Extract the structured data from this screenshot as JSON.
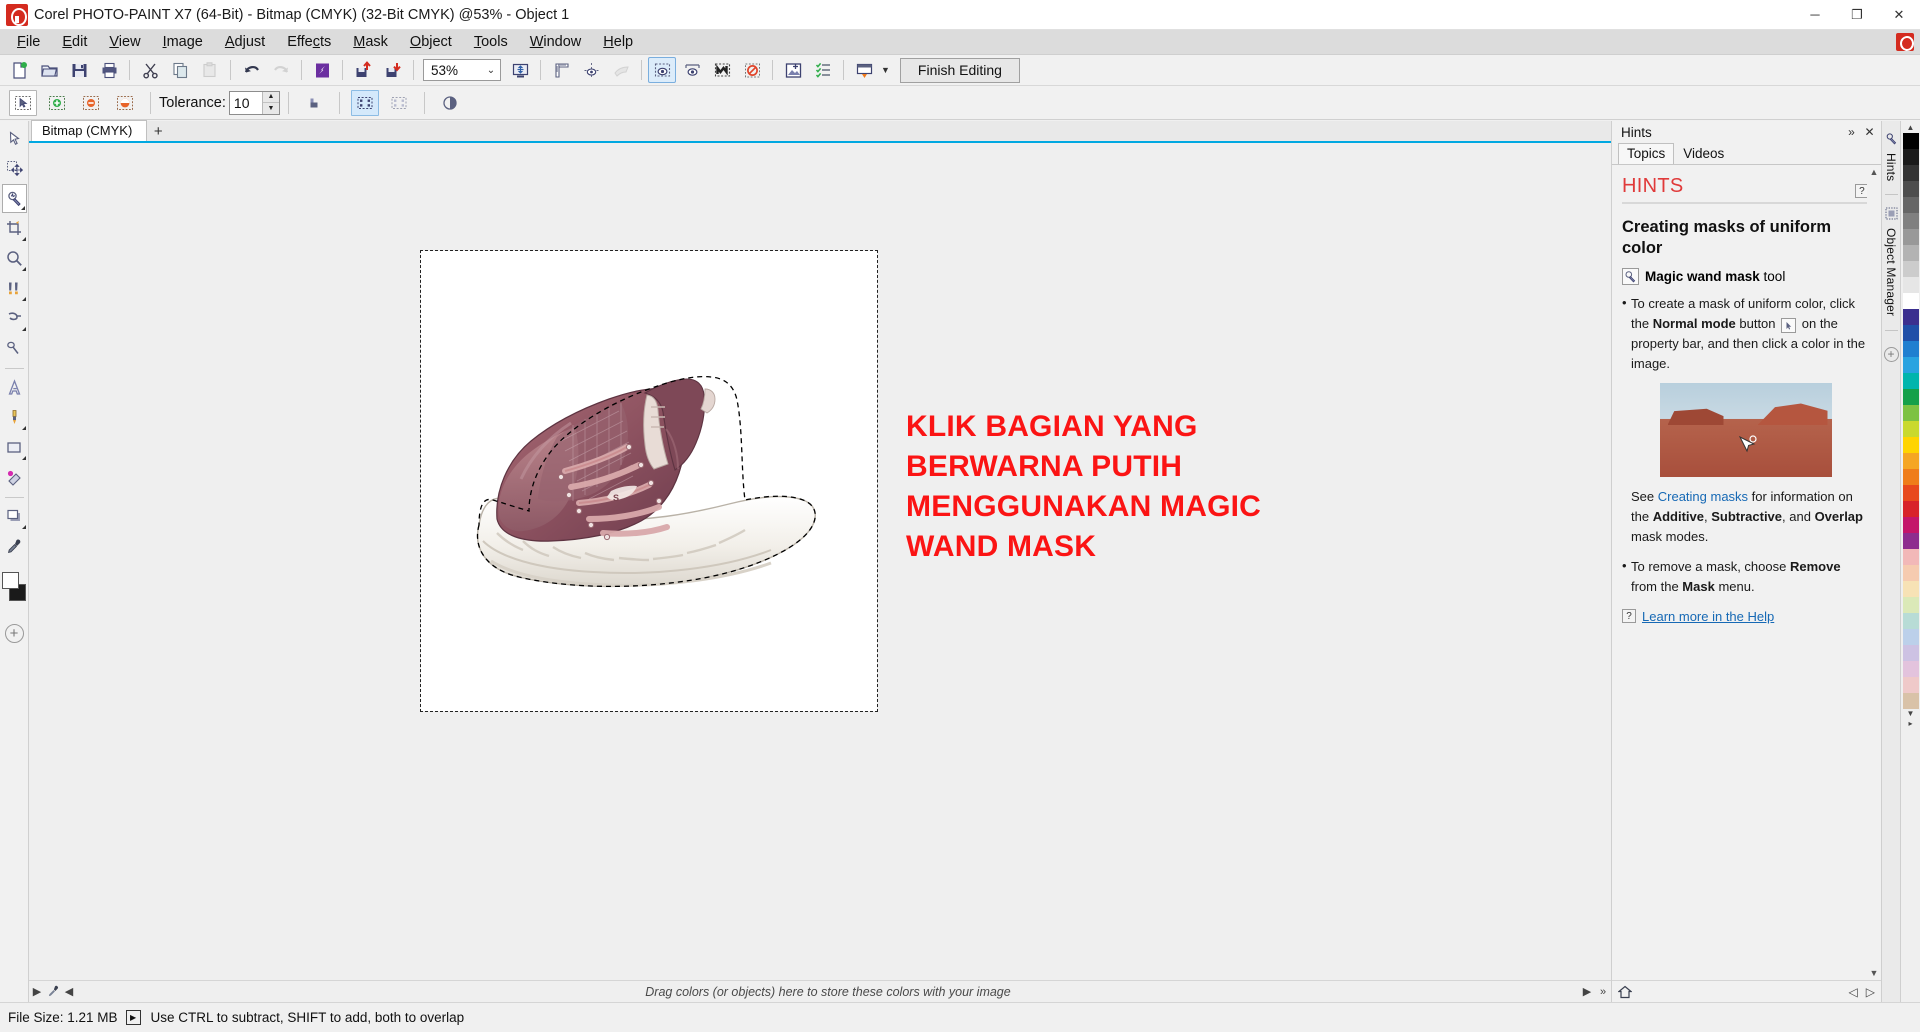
{
  "window": {
    "title": "Corel PHOTO-PAINT X7 (64-Bit) - Bitmap (CMYK) (32-Bit CMYK) @53% - Object 1",
    "logo_name": "corel-photo-paint-logo",
    "minimize": "─",
    "maximize": "❐",
    "close": "✕"
  },
  "menu": {
    "items": [
      {
        "pre": "",
        "key": "F",
        "post": "ile"
      },
      {
        "pre": "",
        "key": "E",
        "post": "dit"
      },
      {
        "pre": "",
        "key": "V",
        "post": "iew"
      },
      {
        "pre": "",
        "key": "I",
        "post": "mage"
      },
      {
        "pre": "",
        "key": "A",
        "post": "djust"
      },
      {
        "pre": "Effe",
        "key": "c",
        "post": "ts"
      },
      {
        "pre": "",
        "key": "M",
        "post": "ask"
      },
      {
        "pre": "",
        "key": "O",
        "post": "bject"
      },
      {
        "pre": "",
        "key": "T",
        "post": "ools"
      },
      {
        "pre": "",
        "key": "W",
        "post": "indow"
      },
      {
        "pre": "",
        "key": "H",
        "post": "elp"
      }
    ]
  },
  "toolbar": {
    "buttons": [
      {
        "name": "new-document",
        "label": "New"
      },
      {
        "name": "open-document",
        "label": "Open"
      },
      {
        "name": "save-document",
        "label": "Save"
      },
      {
        "name": "print-document",
        "label": "Print"
      },
      {
        "name": "cut",
        "label": "Cut"
      },
      {
        "name": "copy",
        "label": "Copy"
      },
      {
        "name": "paste",
        "label": "Paste"
      },
      {
        "name": "undo",
        "label": "Undo"
      },
      {
        "name": "redo",
        "label": "Redo"
      },
      {
        "name": "import",
        "label": "Import"
      },
      {
        "name": "export",
        "label": "Export"
      },
      {
        "name": "publish-to-pdf",
        "label": "Publish to PDF"
      }
    ],
    "zoom_value": "53%",
    "zoom_caret": "⌄",
    "finish_editing_label": "Finish Editing",
    "right_buttons": [
      {
        "name": "fit-to-window",
        "label": "Zoom levels"
      },
      {
        "name": "rulers-toggle",
        "label": "Rulers"
      },
      {
        "name": "guidelines-toggle",
        "label": "Guidelines"
      },
      {
        "name": "snap-to-toggle",
        "label": "Snap To"
      },
      {
        "name": "mask-visibility",
        "label": "Mask Overlay"
      },
      {
        "name": "mask-marquee",
        "label": "Marquee Visible"
      },
      {
        "name": "mask-overlay",
        "label": "Mask Overlay"
      },
      {
        "name": "clip-mask-off",
        "label": "Clip Mask"
      },
      {
        "name": "new-object",
        "label": "New Object"
      },
      {
        "name": "object-manager",
        "label": "Object Manager"
      },
      {
        "name": "application-launcher",
        "label": "Application Launcher"
      }
    ]
  },
  "propertybar": {
    "modes": [
      {
        "name": "normal-mode",
        "label": "Normal",
        "state": "selected"
      },
      {
        "name": "additive-mode",
        "label": "Additive",
        "state": "off"
      },
      {
        "name": "subtractive-mode",
        "label": "Subtractive",
        "state": "off"
      },
      {
        "name": "xor-mode",
        "label": "XOR",
        "state": "off"
      }
    ],
    "tolerance_label": "Tolerance:",
    "tolerance_value": "10",
    "spin_up": "▲",
    "spin_down": "▼",
    "anti_alias_label": "Anti-aliasing",
    "mask_modes": [
      {
        "name": "normal-marquee",
        "label": "Normal",
        "state": "highlight"
      },
      {
        "name": "feather-mask",
        "label": "Feather",
        "state": "off"
      }
    ],
    "extra_label": "Mask transparency"
  },
  "toolbox": {
    "tools": [
      {
        "name": "pick-tool",
        "label": "Pick",
        "flyout": false,
        "selected": false
      },
      {
        "name": "mask-transform-tool",
        "label": "Mask Transform",
        "flyout": false,
        "selected": false
      },
      {
        "name": "magic-wand-mask-tool",
        "label": "Magic Wand Mask",
        "flyout": true,
        "selected": true
      },
      {
        "name": "crop-tool",
        "label": "Crop",
        "flyout": true,
        "selected": false
      },
      {
        "name": "zoom-tool",
        "label": "Zoom",
        "flyout": true,
        "selected": false
      },
      {
        "name": "eraser-tool",
        "label": "Eraser",
        "flyout": true,
        "selected": false
      },
      {
        "name": "smear-tool",
        "label": "Effect",
        "flyout": true,
        "selected": false
      },
      {
        "name": "clone-tool",
        "label": "Clone",
        "flyout": false,
        "selected": false
      },
      {
        "name": "text-tool",
        "label": "Text",
        "flyout": false,
        "selected": false
      },
      {
        "name": "paint-tool",
        "label": "Paint",
        "flyout": true,
        "selected": false
      },
      {
        "name": "rectangle-tool",
        "label": "Rectangle",
        "flyout": true,
        "selected": false
      },
      {
        "name": "fill-tool",
        "label": "Fill",
        "flyout": false,
        "selected": false
      },
      {
        "name": "object-drop-shadow-tool",
        "label": "Drop Shadow",
        "flyout": true,
        "selected": false
      },
      {
        "name": "eyedropper-tool",
        "label": "Eyedropper",
        "flyout": false,
        "selected": false
      },
      {
        "name": "interactive-fill-tool",
        "label": "Interactive Fill",
        "flyout": true,
        "selected": false
      }
    ],
    "foreground_color": "#ffffff",
    "background_color": "#1a1a1a",
    "add_tool_label": "+"
  },
  "document": {
    "tab_label": "Bitmap (CMYK)",
    "add_tab_label": "+",
    "annotation": [
      "KLIK BAGIAN YANG",
      "BERWARNA PUTIH",
      "MENGGUNAKAN MAGIC",
      "WAND MASK"
    ],
    "annotation_color": "#fb1414",
    "color_hint": "Drag colors (or objects) here to store these colors with your image"
  },
  "docker": {
    "title": "Hints",
    "collapse_icon": "»",
    "close_icon": "✕",
    "tabs": [
      {
        "name": "tab-topics",
        "label": "Topics",
        "active": true
      },
      {
        "name": "tab-videos",
        "label": "Videos",
        "active": false
      }
    ],
    "heading": "HINTS",
    "help_marker": "?",
    "subheading": "Creating masks of uniform color",
    "tool_name_bold": "Magic wand mask",
    "tool_name_rest": " tool",
    "bullet1_a": "To create a mask of uniform color, click the ",
    "bullet1_b": "Normal mode",
    "bullet1_c": " button ",
    "bullet1_d": " on the property bar, and then click a color in the image.",
    "see_prefix": "See ",
    "see_link": "Creating masks",
    "see_mid": " for information on the ",
    "see_bold1": "Additive",
    "see_comma1": ", ",
    "see_bold2": "Subtractive",
    "see_comma2": ", and ",
    "see_bold3": "Overlap",
    "see_suffix": " mask modes.",
    "bullet2_a": "To remove a mask, choose ",
    "bullet2_b": "Remove",
    "bullet2_c": " from the ",
    "bullet2_d": "Mask",
    "bullet2_e": " menu.",
    "learn_more": "Learn more in the Help",
    "footer_home": "home-icon",
    "footer_back": "◁",
    "footer_forward": "▷"
  },
  "vertical_tabs": [
    {
      "name": "vtab-hints",
      "label": "Hints"
    },
    {
      "name": "vtab-object-manager",
      "label": "Object Manager"
    }
  ],
  "palette": {
    "up_arrow": "▲",
    "down_arrow": "▼",
    "more_arrow": "▸",
    "colors": [
      "#000000",
      "#1a1a1a",
      "#333333",
      "#4d4d4d",
      "#666666",
      "#808080",
      "#999999",
      "#b3b3b3",
      "#cccccc",
      "#e6e6e6",
      "#ffffff",
      "#3b2f8f",
      "#1f4fa8",
      "#1f7fd0",
      "#29a3e0",
      "#00b5ad",
      "#14a04a",
      "#7dc242",
      "#c9d92e",
      "#ffd400",
      "#f5a623",
      "#ef7d1a",
      "#e8491d",
      "#d8232a",
      "#c4166a",
      "#8e2d8e",
      "#f2b8b8",
      "#f6cbb0",
      "#f7e2b5",
      "#dbe9b8",
      "#b8dcd6",
      "#bcd0ea",
      "#cdc2e3",
      "#e3c3dd",
      "#efc9c9",
      "#d9c2a8"
    ]
  },
  "statusbar": {
    "file_size_label": "File Size: 1.21 MB",
    "playback_icon": "▶",
    "hint": "Use CTRL to subtract, SHIFT to add, both to overlap"
  }
}
